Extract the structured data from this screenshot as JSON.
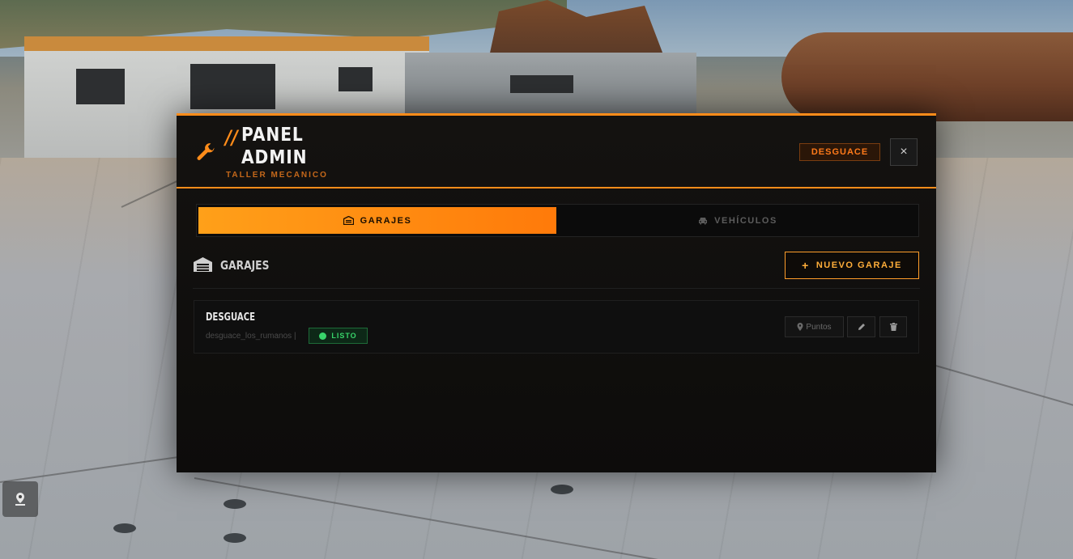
{
  "panel": {
    "slashes": "//",
    "title_line1": "PANEL",
    "title_line2": "ADMIN",
    "subtitle": "TALLER MECANICO",
    "badge": "DESGUACE",
    "close_label": "×",
    "accent_color": "#ff8c1a"
  },
  "tabs": [
    {
      "label": "GARAJES",
      "icon": "garage-icon",
      "active": true
    },
    {
      "label": "VEHÍCULOS",
      "icon": "car-icon",
      "active": false
    }
  ],
  "section": {
    "title": "GARAJES",
    "new_button_label": "NUEVO GARAJE",
    "new_button_icon": "plus-icon"
  },
  "garages": [
    {
      "name": "DESGUACE",
      "id": "desguace_los_rumanos |",
      "status": "LISTO",
      "status_color": "#38d46a",
      "actions": {
        "points_label": "Puntos"
      }
    }
  ]
}
